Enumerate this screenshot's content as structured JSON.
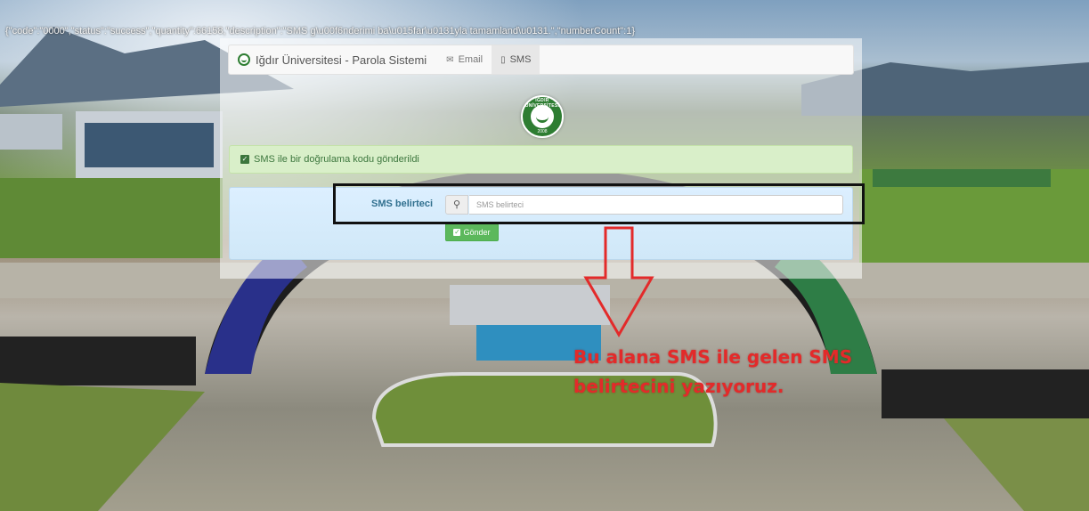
{
  "raw_response": "{\"code\":\"0000\",\"status\":\"success\",\"quantity\":66158,\"description\":\"SMS g\\u00f6nderimi ba\\u015far\\u0131yla tamamland\\u0131.\",\"numberCount\":1}",
  "navbar": {
    "brand": "Iğdır Üniversitesi - Parola Sistemi",
    "tabs": [
      {
        "label": "Email",
        "icon": "envelope-icon"
      },
      {
        "label": "SMS",
        "icon": "mobile-icon",
        "active": true
      }
    ]
  },
  "emblem": {
    "ring_text": "IĞDIR ÜNİVERSİTESİ",
    "year": "2008"
  },
  "alert": {
    "message": "SMS ile bir doğrulama kodu gönderildi"
  },
  "form": {
    "label": "SMS belirteci",
    "input_value": "",
    "input_placeholder": "SMS belirteci",
    "submit_label": "Gönder"
  },
  "annotation": {
    "line1": "Bu alana SMS ile gelen SMS",
    "line2": "belirtecini yazıyoruz."
  },
  "colors": {
    "accent_green": "#5cb85c",
    "alert_green_bg": "#d9efc9",
    "annotation_red": "#e32a2a",
    "label_blue": "#31708f"
  }
}
